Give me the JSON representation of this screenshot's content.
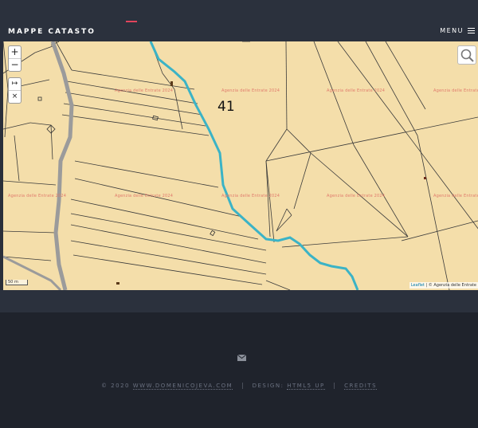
{
  "header": {
    "brand": "MAPPE CATASTO",
    "menu_label": "MENU"
  },
  "map": {
    "zoom_in": "+",
    "zoom_out": "−",
    "measure": "↦",
    "clear": "×",
    "parcel_number": "41",
    "watermark": "Agenzia delle Entrate 2024",
    "scale": "50 m",
    "attribution_link": "Leaflet",
    "attribution_text": " | © Agenzia delle Entrate",
    "colors": {
      "base": "#f4deaa",
      "river": "#3bb3c6",
      "road": "#9b9b9b",
      "parcel_line": "#3a3a3a"
    }
  },
  "footer": {
    "copyright": "© 2020",
    "site_link": "WWW.DOMENICOJEVA.COM",
    "design_prefix": "DESIGN: ",
    "design_link": "HTML5 UP",
    "credits_link": "CREDITS"
  }
}
